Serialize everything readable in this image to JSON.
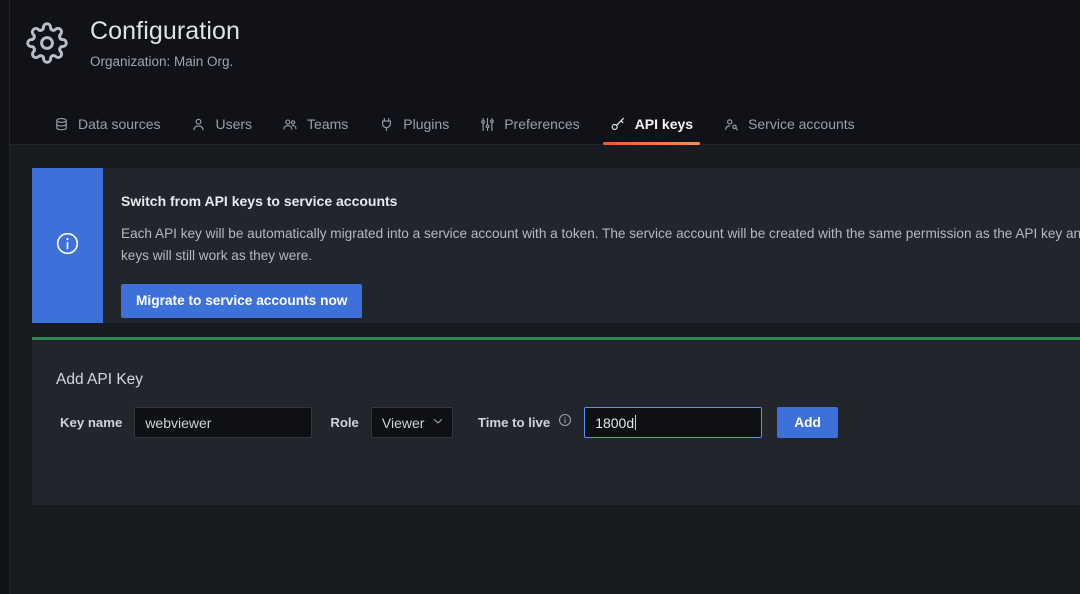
{
  "header": {
    "title": "Configuration",
    "subtitle": "Organization: Main Org.",
    "icon": "gear-icon"
  },
  "tabs": [
    {
      "label": "Data sources",
      "icon": "database-icon",
      "active": false
    },
    {
      "label": "Users",
      "icon": "user-icon",
      "active": false
    },
    {
      "label": "Teams",
      "icon": "users-group-icon",
      "active": false
    },
    {
      "label": "Plugins",
      "icon": "plug-icon",
      "active": false
    },
    {
      "label": "Preferences",
      "icon": "sliders-icon",
      "active": false
    },
    {
      "label": "API keys",
      "icon": "key-icon",
      "active": true
    },
    {
      "label": "Service accounts",
      "icon": "user-gear-icon",
      "active": false
    }
  ],
  "banner": {
    "icon": "info-circle-icon",
    "title": "Switch from API keys to service accounts",
    "text": "Each API key will be automatically migrated into a service account with a token. The service account will be created with the same permission as the API key and current API keys will still work as they were.",
    "button_label": "Migrate to service accounts now"
  },
  "add_key_panel": {
    "heading": "Add API Key",
    "key_name_label": "Key name",
    "key_name_value": "webviewer",
    "role_label": "Role",
    "role_value": "Viewer",
    "role_caret_icon": "chevron-down-icon",
    "ttl_label": "Time to live",
    "ttl_info_icon": "info-circle-icon",
    "ttl_value": "1800d",
    "add_button_label": "Add"
  },
  "colors": {
    "accent_orange": "#f05a28",
    "primary_blue": "#3d71d9",
    "panel_green": "#2f8a52",
    "focus_blue": "#5794f2",
    "page_bg": "#181b1f",
    "panel_bg": "#22252b",
    "chrome_bg": "#111217"
  }
}
